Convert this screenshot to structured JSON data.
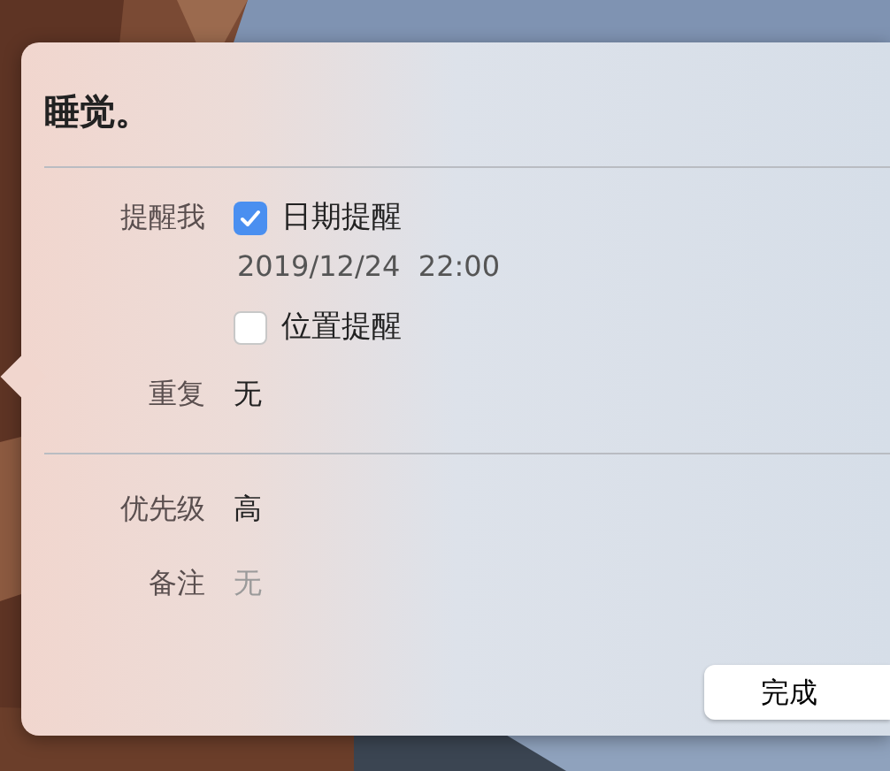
{
  "title": "睡觉。",
  "remind_me": {
    "label": "提醒我",
    "options": [
      {
        "label": "日期提醒",
        "checked": true,
        "detail": "2019/12/24  22:00"
      },
      {
        "label": "位置提醒",
        "checked": false
      }
    ]
  },
  "repeat": {
    "label": "重复",
    "value": "无"
  },
  "priority": {
    "label": "优先级",
    "value": "高"
  },
  "notes": {
    "label": "备注",
    "placeholder": "无"
  },
  "buttons": [
    {
      "label": "完成"
    }
  ]
}
